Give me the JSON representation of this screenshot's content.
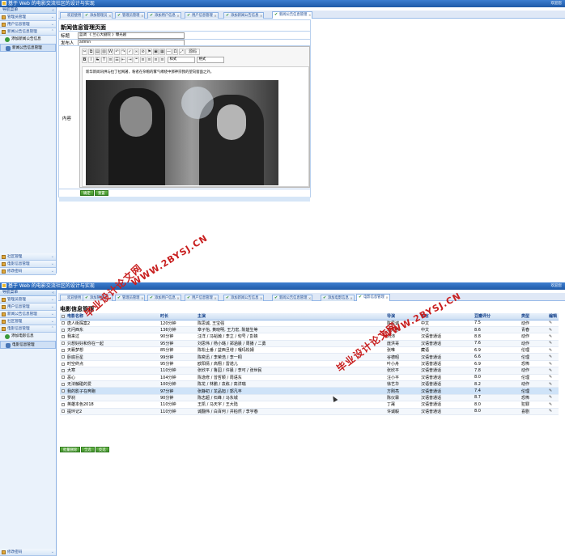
{
  "app": {
    "title": "基于 Web 的电影交流社区的设计与实现",
    "user_corner": "欢迎您",
    "nav_head": "导航菜单"
  },
  "screen1": {
    "groups_top": [
      "管理员管理",
      "用户信息管理",
      "新闻公告信息管理"
    ],
    "subitems": [
      "添加新闻公告信息",
      "新闻公告信息管理"
    ],
    "groups_bottom": [
      "社区管理",
      "电影信息管理",
      "修改密码"
    ],
    "tabs": [
      "欢迎使用",
      "添加管理员",
      "管理员管理",
      "添加用户信息",
      "用户信息管理",
      "添加新闻公告信息",
      "新闻公告信息管理"
    ],
    "page_title": "新闻信息管理页面",
    "field_title_label": "标题",
    "field_title_value": "蓝调 《 兰心大剧院 》曝光剧",
    "field_author_label": "发布人",
    "field_author_value": "admin",
    "content_label": "内容",
    "editor": {
      "source_label": "源码",
      "style_select": "样式",
      "format_select": "格式",
      "body_text": "新华新闻讯供与拉丁拉网著，粉者在杂粮的雾气缭绕中那神宗我的望向窗面之外。"
    },
    "buttons": [
      "确定",
      "重置"
    ]
  },
  "screen2": {
    "groups_top": [
      "管理员管理",
      "用户信息管理",
      "新闻公告信息管理",
      "社区管理",
      "电影信息管理"
    ],
    "subitems": [
      "添加电影信息",
      "电影信息管理"
    ],
    "groups_bottom": [
      "修改密码"
    ],
    "tabs": [
      "欢迎使用",
      "添加管理员",
      "管理员管理",
      "添加用户信息",
      "用户信息管理",
      "添加新闻公告信息",
      "新闻公告信息管理",
      "添加电影信息",
      "电影信息管理"
    ],
    "page_title": "电影信息管理",
    "columns": [
      "电影名称",
      "时长",
      "主演",
      "导演",
      "语言",
      "豆瓣评分",
      "类型",
      "编辑"
    ],
    "rows": [
      [
        "唐人街探案2",
        "120分钟",
        "陈思诚, 王宝强",
        "陈思诚",
        "中文",
        "7.5",
        "动作"
      ],
      [
        "无问西东",
        "136分钟",
        "章子怡, 黄晓明, 王力宏, 陈楚生等",
        "李芳芳",
        "中文",
        "8.6",
        "青春"
      ],
      [
        "我来过",
        "90分钟",
        "汪洋 / 冯韬瀚 / 李立 / 旬号 / 彭婧",
        "刘沛",
        "汉语普通话",
        "8.8",
        "动作"
      ],
      [
        "只想好好和你在一起",
        "95分钟",
        "刘思伟 / 杨小璐 / 郑涵晨 / 周播 / 二勇",
        "庞洪哥",
        "汉语普通话",
        "7.6",
        "动作"
      ],
      [
        "天籁梦想",
        "85分钟",
        "陈松土番 / 益西旦增 / 嘎玛松姆",
        "张唯",
        "藏语",
        "6.9",
        "伦理"
      ],
      [
        "卧底巨星",
        "99分钟",
        "陈奕迅 / 李荣浩 / 李一桐",
        "谷德昭",
        "汉语普通话",
        "6.6",
        "伦理"
      ],
      [
        "时空终点",
        "95分钟",
        "欧阳倩 / 高翔 / 雷诺儿",
        "叶小舟",
        "汉语普通话",
        "6.9",
        "恐怖"
      ],
      [
        "大寒",
        "110分钟",
        "张欣平 / 鲁园 / 许晨 / 李可 / 张世民",
        "张欣平",
        "汉语普通话",
        "7.8",
        "动作"
      ],
      [
        "恶心",
        "104分钟",
        "陈逸修 / 曾哲颖 / 周语东",
        "汪小平",
        "汉语普通话",
        "8.0",
        "伦理"
      ],
      [
        "无法触碰的爱",
        "100分钟",
        "陈龙 / 林鹏 / 袁栋 / 高洋瑞",
        "徐艺华",
        "汉语普通话",
        "8.2",
        "动作"
      ],
      [
        "我的影子在奔跑",
        "97分钟",
        "张静初 / 龙品旭 / 郭凡丰",
        "方刚亮",
        "汉语普通话",
        "7.4",
        "伦理"
      ],
      [
        "罗刹",
        "90分钟",
        "陈志超 / 石峰 / 马东城",
        "陈仪霖",
        "汉语普通话",
        "8.7",
        "恐怖"
      ],
      [
        "英雄本色2018",
        "110分钟",
        "王凯 / 马天宇 / 王大陆",
        "丁晟",
        "汉语普通话",
        "8.0",
        "犯罪"
      ],
      [
        "提环记2",
        "110分钟",
        "诚翻伟 / 白百何 / 井柏然 / 李宇春",
        "许诚毅",
        "汉语普通话",
        "8.0",
        "喜剧"
      ]
    ],
    "buttons": [
      "批量删除",
      "全选",
      "反选"
    ]
  },
  "watermarks": [
    "毕业设计论文网",
    "WWW.2BYSJ.CN"
  ],
  "icons": {
    "tab_tick": "check-icon",
    "tab_close": "close-icon",
    "group": "folder-icon",
    "chevron": "chevron-down-icon",
    "edit": "pencil-icon"
  },
  "colors": {
    "titlebar": "#2f6cbd",
    "sidebar_bg": "#eaf2fb",
    "tab_border": "#8db2e3",
    "button_green": "#4f9f36",
    "watermark_red": "#c81e1e"
  }
}
